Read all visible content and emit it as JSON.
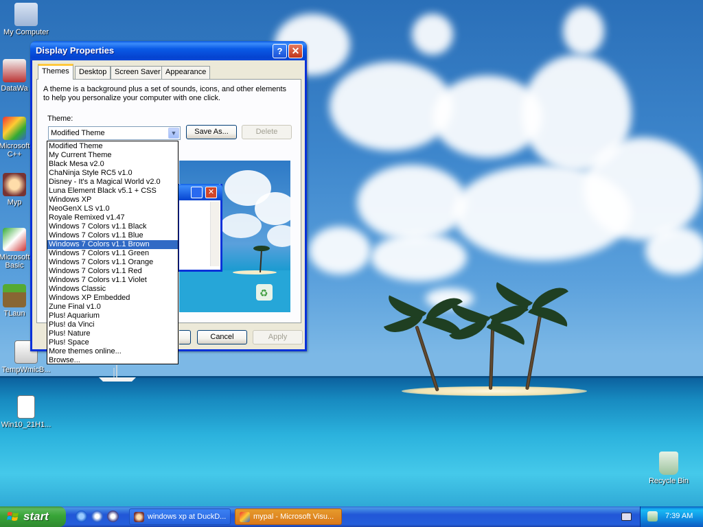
{
  "desktop": {
    "icons": [
      {
        "label": "My Computer"
      },
      {
        "label": "DataWa"
      },
      {
        "label": "Microsoft\nC++"
      },
      {
        "label": "Myp"
      },
      {
        "label": "Microsoft\nBasic"
      },
      {
        "label": "TLaun"
      },
      {
        "label": "TempWmicB..."
      },
      {
        "label": "Win10_21H1..."
      },
      {
        "label": "Recycle Bin"
      }
    ]
  },
  "window": {
    "title": "Display Properties",
    "help_glyph": "?",
    "close_glyph": "✕",
    "tabs": [
      {
        "label": "Themes"
      },
      {
        "label": "Desktop"
      },
      {
        "label": "Screen Saver"
      },
      {
        "label": "Appearance"
      }
    ],
    "description": "A theme is a background plus a set of sounds, icons, and other elements to help you personalize your computer with one click.",
    "theme_label": "Theme:",
    "theme_value": "Modified Theme",
    "save_as_label": "Save As...",
    "delete_label": "Delete",
    "ok_label": "",
    "cancel_label": "Cancel",
    "apply_label": "Apply"
  },
  "theme_list": {
    "selected": "Windows 7 Colors v1.1 Brown",
    "options": [
      "Modified Theme",
      "My Current Theme",
      "Black Mesa v2.0",
      "ChaNinja Style RC5 v1.0",
      "Disney - It's a Magical World v2.0",
      "Luna Element Black v5.1 + CSS",
      "Windows XP",
      "NeoGenX LS v1.0",
      "Royale Remixed v1.47",
      "Windows 7 Colors v1.1 Black",
      "Windows 7 Colors v1.1 Blue",
      "Windows 7 Colors v1.1 Brown",
      "Windows 7 Colors v1.1 Green",
      "Windows 7 Colors v1.1 Orange",
      "Windows 7 Colors v1.1 Red",
      "Windows 7 Colors v1.1 Violet",
      "Windows Classic",
      "Windows XP Embedded",
      "Zune Final v1.0",
      "Plus! Aquarium",
      "Plus! da Vinci",
      "Plus! Nature",
      "Plus! Space",
      "More themes online...",
      "Browse..."
    ]
  },
  "taskbar": {
    "start_label": "start",
    "tasks": [
      {
        "label": "windows xp at DuckD..."
      },
      {
        "label": "mypal - Microsoft Visu..."
      }
    ],
    "clock": "7:39 AM"
  },
  "colors": {
    "selection": "#316ac5",
    "titlebar": "#0a5ae6",
    "start_green": "#38a538"
  }
}
